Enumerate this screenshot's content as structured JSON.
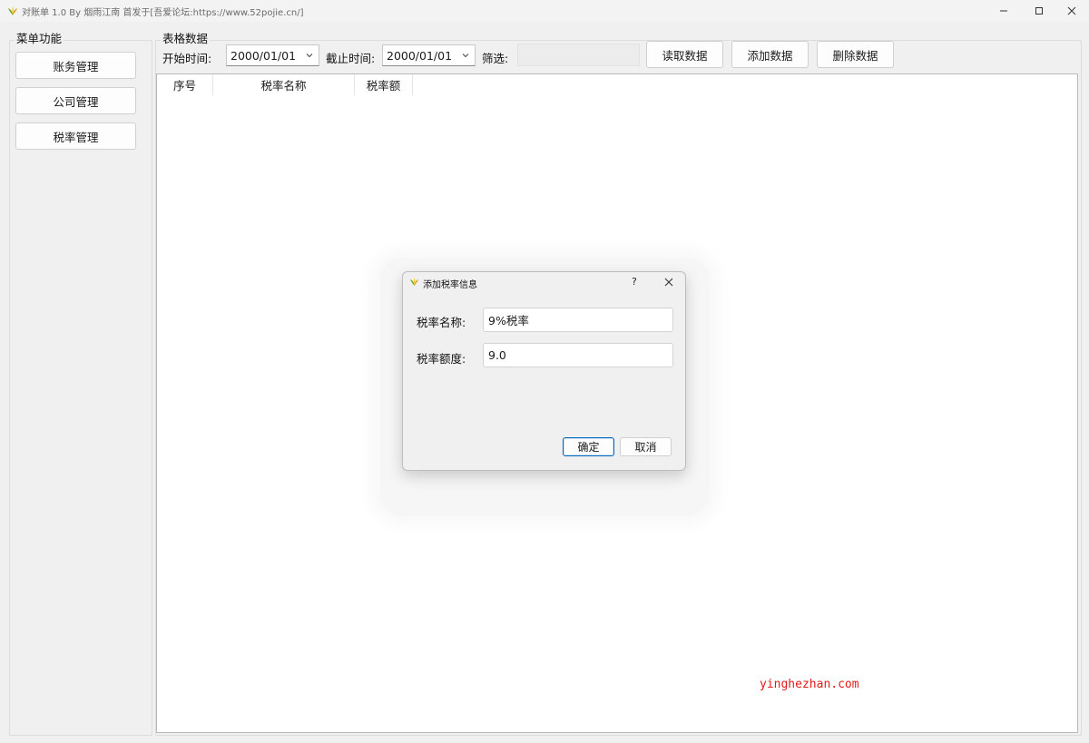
{
  "window": {
    "title": "对账单 1.0 By 烟雨江南 首发于[吾爱论坛:https://www.52pojie.cn/]",
    "minimize_icon": "minimize-icon",
    "maximize_icon": "maximize-icon",
    "close_icon": "close-icon"
  },
  "menu": {
    "title": "菜单功能",
    "items": [
      {
        "label": "账务管理"
      },
      {
        "label": "公司管理"
      },
      {
        "label": "税率管理"
      }
    ]
  },
  "table_panel": {
    "title": "表格数据",
    "start_label": "开始时间:",
    "start_value": "2000/01/01",
    "end_label": "截止时间:",
    "end_value": "2000/01/01",
    "filter_label": "筛选:",
    "filter_value": "",
    "buttons": {
      "read": "读取数据",
      "add": "添加数据",
      "delete": "删除数据"
    },
    "columns": [
      "序号",
      "税率名称",
      "税率额"
    ]
  },
  "dialog": {
    "title": "添加税率信息",
    "help_label": "?",
    "name_label": "税率名称:",
    "name_value": "9%税率",
    "amount_label": "税率额度:",
    "amount_value": "9.0",
    "ok_label": "确定",
    "cancel_label": "取消"
  },
  "watermark": "yinghezhan.com",
  "colors": {
    "accent": "#0067c0",
    "watermark": "#e21b1b"
  }
}
